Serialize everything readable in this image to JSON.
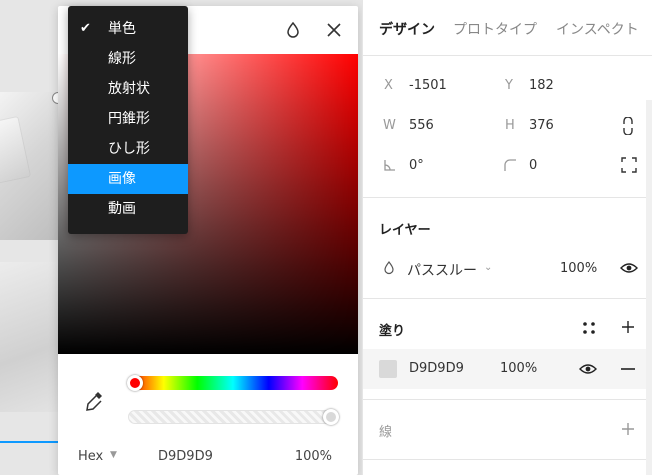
{
  "dropdown": {
    "items": [
      {
        "label": "単色",
        "checked": true,
        "highlighted": false
      },
      {
        "label": "線形",
        "checked": false,
        "highlighted": false
      },
      {
        "label": "放射状",
        "checked": false,
        "highlighted": false
      },
      {
        "label": "円錐形",
        "checked": false,
        "highlighted": false
      },
      {
        "label": "ひし形",
        "checked": false,
        "highlighted": false
      },
      {
        "label": "画像",
        "checked": false,
        "highlighted": true
      },
      {
        "label": "動画",
        "checked": false,
        "highlighted": false
      }
    ],
    "check_glyph": "✔"
  },
  "picker": {
    "hue_color": "#ff0000",
    "hex_mode": "Hex",
    "hex_value": "D9D9D9",
    "alpha": "100%"
  },
  "panel": {
    "tabs": [
      "デザイン",
      "プロトタイプ",
      "インスペクト"
    ],
    "position": {
      "x_label": "X",
      "x": "-1501",
      "y_label": "Y",
      "y": "182"
    },
    "size": {
      "w_label": "W",
      "w": "556",
      "h_label": "H",
      "h": "376"
    },
    "rotation": "0°",
    "corner_radius": "0",
    "layer": {
      "title": "レイヤー",
      "blend": "パススルー",
      "opacity": "100%"
    },
    "fill": {
      "title": "塗り",
      "hex": "D9D9D9",
      "opacity": "100%",
      "color": "#d9d9d9"
    },
    "stroke": {
      "title": "線"
    }
  },
  "colors": {
    "accent": "#0d99ff",
    "menu_bg": "#1e1e1e"
  }
}
